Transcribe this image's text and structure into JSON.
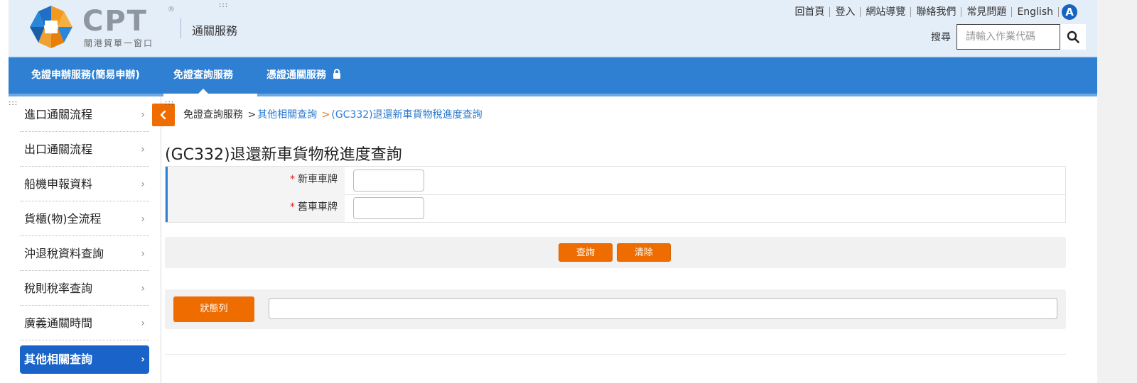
{
  "header": {
    "logo_text": "CPT",
    "logo_registered": "®",
    "logo_subtitle": "關港貿單一窗口",
    "service_title": "通關服務",
    "top_links": [
      "回首頁",
      "登入",
      "網站導覽",
      "聯絡我們",
      "常見問題",
      "English"
    ],
    "accessibility_badge": "A",
    "search_label": "搜尋",
    "search_placeholder": "請輸入作業代碼",
    "search_icon": "search-icon",
    "dots": ":::"
  },
  "nav": {
    "items": [
      {
        "label": "免證申辦服務(簡易申辦)",
        "active": false
      },
      {
        "label": "免證查詢服務",
        "active": true
      },
      {
        "label": "憑證通關服務",
        "active": false,
        "icon": "lock-icon"
      }
    ]
  },
  "sidebar": {
    "items": [
      {
        "label": "進口通關流程"
      },
      {
        "label": "出口通關流程"
      },
      {
        "label": "船機申報資料"
      },
      {
        "label": "貨櫃(物)全流程"
      },
      {
        "label": "沖退稅資料查詢"
      },
      {
        "label": "稅則稅率查詢"
      },
      {
        "label": "廣義通關時間"
      },
      {
        "label": "其他相關查詢",
        "active": true
      }
    ],
    "chevron": "›"
  },
  "content": {
    "breadcrumb": {
      "first": "免證查詢服務",
      "sep": ">",
      "second": "其他相關查詢",
      "third": "(GC332)退還新車貨物稅進度查詢"
    },
    "title": "(GC332)退還新車貨物稅進度查詢",
    "form": {
      "required_mark": "*",
      "fields": [
        {
          "label": "新車車牌",
          "value": ""
        },
        {
          "label": "舊車車牌",
          "value": ""
        }
      ]
    },
    "buttons": {
      "query": "查詢",
      "clear": "清除"
    },
    "status": {
      "button": "狀態列",
      "value": ""
    }
  },
  "colors": {
    "header_bg": "#e4eef9",
    "nav_bg": "#2f80d2",
    "accent_orange": "#ef6c00",
    "sidebar_active": "#1a63c8"
  }
}
